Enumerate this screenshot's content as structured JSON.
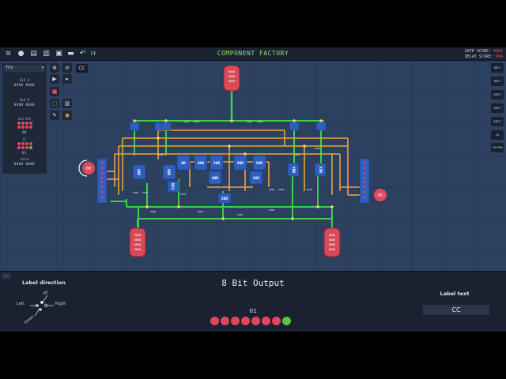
{
  "topbar": {
    "title": "COMPONENT FACTORY",
    "ff_label": "FF",
    "gate_score_label": "GATE SCORE:",
    "gate_score_value": "4491",
    "delay_score_label": "DELAY SCORE:",
    "delay_score_value": "994",
    "icons": [
      "menu-icon",
      "chat-icon",
      "book-icon",
      "document-icon",
      "save-icon",
      "keyboard-icon",
      "undo-icon"
    ]
  },
  "left_panel": {
    "tick_label": "Tick",
    "alu_a_label": "ALU A",
    "alu_a_bits": "0000 0000",
    "alu_b_label": "ALU B",
    "alu_b_bits": "0000 0000",
    "alu_res_label": "ALU Res",
    "alu_res_value": "00",
    "cc_label": "CC",
    "cc_value": "01",
    "value_label": "value",
    "value_bits": "0000 0000"
  },
  "canvas": {
    "cc_chip": "CC",
    "gate_labels": [
      "ADD",
      "ADD",
      "NEG",
      "OR",
      "AND",
      "XOR",
      "AND",
      "XOR",
      "XOR",
      "XNR",
      "XNR",
      "XOR",
      "XOR"
    ],
    "left_badge": "00",
    "right_badge": "00",
    "bits_label": "0000"
  },
  "right_toolbox": [
    "8BIT",
    "8BIT",
    "16BIT",
    "32BIT",
    "64BIT",
    "IO",
    "CUSTOM"
  ],
  "bottom": {
    "label_direction_title": "Label direction",
    "dir_left": "Left",
    "dir_right": "Right",
    "dir_up": "Up",
    "dir_down": "Down",
    "component_name": "8 Bit Output",
    "output_value": "01",
    "output_bits": [
      0,
      0,
      0,
      0,
      0,
      0,
      0,
      1
    ],
    "label_text_title": "Label text",
    "label_text_value": "CC"
  },
  "colors": {
    "workspace": "#2c4060",
    "wire_green": "#3ccf4e",
    "wire_orange": "#e8a541",
    "pin_red": "#e04a5a",
    "accent_green": "#8ee06b"
  }
}
